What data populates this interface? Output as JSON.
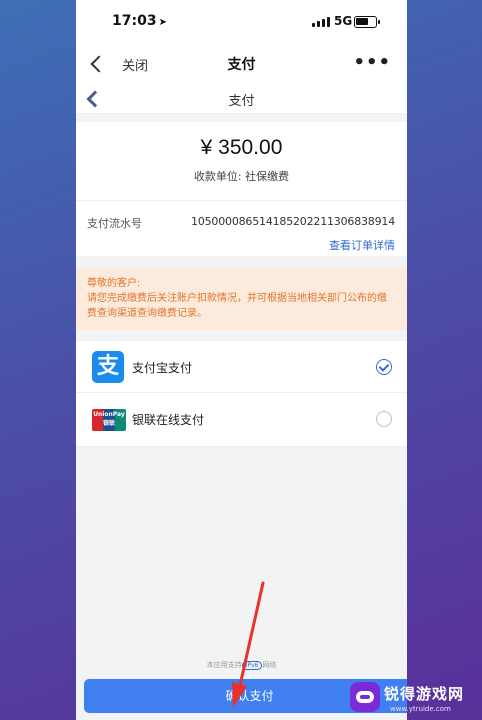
{
  "status_bar": {
    "time": "17:03",
    "network": "5G"
  },
  "topbar": {
    "close_label": "关闭",
    "title": "支付",
    "more_label": "•••"
  },
  "subbar": {
    "title": "支付"
  },
  "payment": {
    "amount": "¥ 350.00",
    "payee": "收款单位: 社保缴费"
  },
  "order": {
    "label": "支付流水号",
    "number": "1050000865141852022113068389​14",
    "detail_link": "查看订单详情"
  },
  "notice": {
    "greeting": "尊敬的客户:",
    "body": "请您完成缴费后关注账户扣款情况，并可根据当地相关部门公布的缴费查询渠道查询缴费记录。"
  },
  "methods": [
    {
      "label": "支付宝支付",
      "logo_char": "支",
      "selected": true
    },
    {
      "label": "银联在线支付",
      "logo_text": "UnionPay 银联",
      "selected": false
    }
  ],
  "footer": {
    "prefix": "本应用支持",
    "badge": "IPv6",
    "suffix": "网络"
  },
  "confirm_label": "确认支付",
  "watermark": {
    "title": "锐得游戏网",
    "url": "www.ytruide.com"
  },
  "colors": {
    "accent": "#2f6bd1",
    "button": "#3f7ff0",
    "notice_text": "#e0752c",
    "notice_bg": "#fcebdd",
    "alipay": "#1b8ceb",
    "annotation_arrow": "#e8322a"
  }
}
